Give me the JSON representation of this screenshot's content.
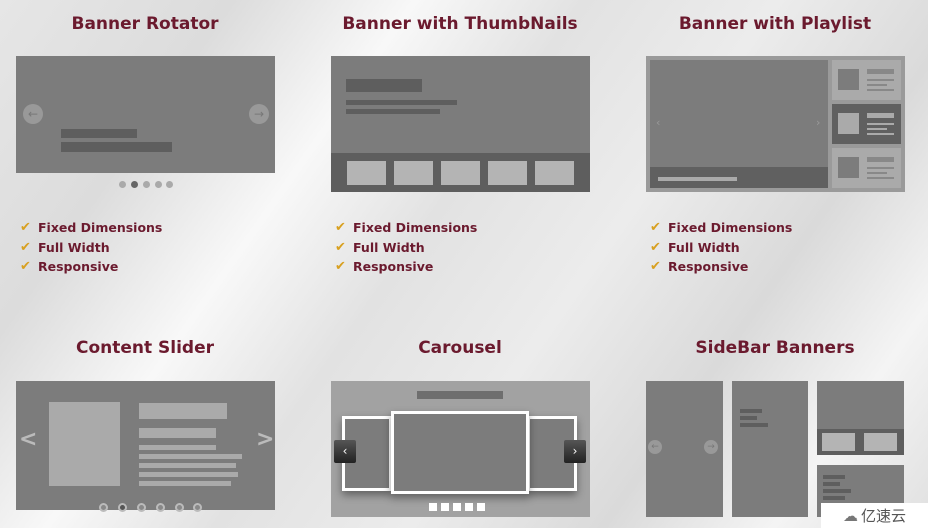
{
  "sections": [
    {
      "title": "Banner Rotator",
      "features": [
        "Fixed Dimensions",
        "Full Width",
        "Responsive"
      ]
    },
    {
      "title": "Banner with ThumbNails",
      "features": [
        "Fixed Dimensions",
        "Full Width",
        "Responsive"
      ]
    },
    {
      "title": "Banner with Playlist",
      "features": [
        "Fixed Dimensions",
        "Full Width",
        "Responsive"
      ]
    },
    {
      "title": "Content Slider"
    },
    {
      "title": "Carousel"
    },
    {
      "title": "SideBar Banners"
    }
  ],
  "icons": {
    "check": "checkmark-icon",
    "prev": "arrow-left-icon",
    "next": "arrow-right-icon"
  },
  "watermark": "亿速云",
  "colors": {
    "title": "#6b1a2e",
    "check": "#d8a020",
    "placeholder": "#7c7c7c"
  }
}
